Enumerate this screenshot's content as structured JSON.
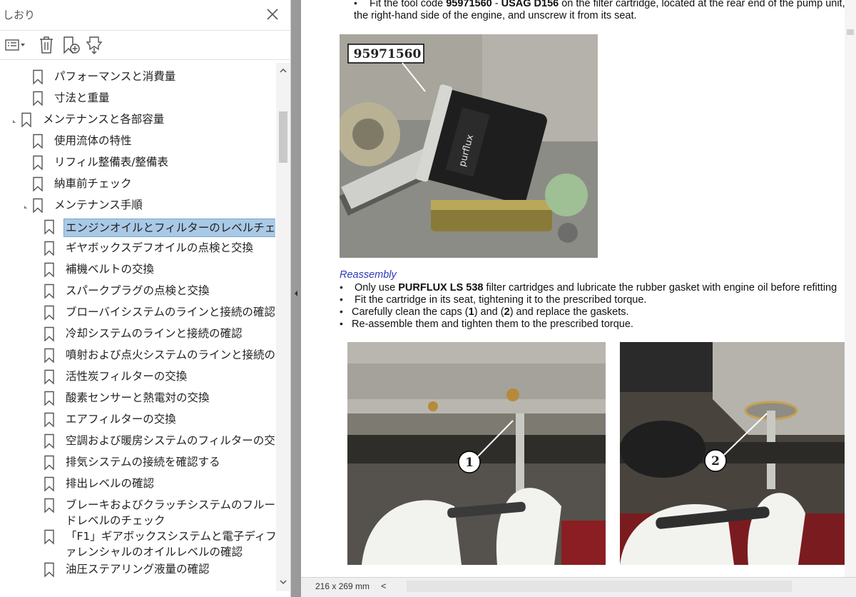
{
  "pane": {
    "title": "しおり",
    "toolbar": [
      "options-icon",
      "trash-icon",
      "new-bookmark-icon",
      "expand-bookmark-icon"
    ],
    "bookmarks": [
      {
        "label": "パフォーマンスと消費量"
      },
      {
        "label": "寸法と重量"
      },
      {
        "label": "メンテナンスと各部容量"
      },
      {
        "label": "使用流体の特性"
      },
      {
        "label": "リフィル整備表/整備表"
      },
      {
        "label": "納車前チェック"
      },
      {
        "label": "メンテナンス手順"
      },
      {
        "label": "エンジンオイルとフィルターのレベルチェックと交換"
      },
      {
        "label": "ギヤボックスデフオイルの点検と交換"
      },
      {
        "label": "補機ベルトの交換"
      },
      {
        "label": "スパークプラグの点検と交換"
      },
      {
        "label": "ブローバイシステムのラインと接続の確認"
      },
      {
        "label": "冷却システムのラインと接続の確認"
      },
      {
        "label": "噴射および点火システムのラインと接続の確認"
      },
      {
        "label": "活性炭フィルターの交換"
      },
      {
        "label": "酸素センサーと熱電対の交換"
      },
      {
        "label": "エアフィルターの交換"
      },
      {
        "label": "空調および暖房システムのフィルターの交換"
      },
      {
        "label": "排気システムの接続を確認する"
      },
      {
        "label": "排出レベルの確認"
      },
      {
        "label": "ブレーキおよびクラッチシステムのフルードレベルのチェック"
      },
      {
        "label": "「F1」ギアボックスシステムと電子ディファレンシャルのオイルレベルの確認"
      },
      {
        "label": "油圧ステアリング液量の確認"
      }
    ]
  },
  "doc": {
    "line1_a": "Fit the tool code ",
    "line1_b": "95971560",
    "line1_c": " - ",
    "line1_d": "USAG D156",
    "line1_e": " on the filter cartridge, located at the rear end of the pump unit, o",
    "line2": "the right-hand side of the engine, and unscrew it from its seat.",
    "photo1_label": "95971560",
    "reassembly": "Reassembly",
    "b1_a": "Only use ",
    "b1_b": "PURFLUX LS 538",
    "b1_c": " filter cartridges and lubricate the rubber gasket with engine oil before refitting",
    "b2": "Fit the cartridge in its seat, tightening it to the prescribed torque.",
    "b3_a": "Carefully clean the caps (",
    "b3_b": "1",
    "b3_c": ") and (",
    "b3_d": "2",
    "b3_e": ") and replace the gaskets.",
    "b4": "Re-assemble them and tighten them to the prescribed torque.",
    "callout1": "1",
    "callout2": "2"
  },
  "status": {
    "page_size": "216 x 269 mm",
    "scroll_left": "<"
  }
}
